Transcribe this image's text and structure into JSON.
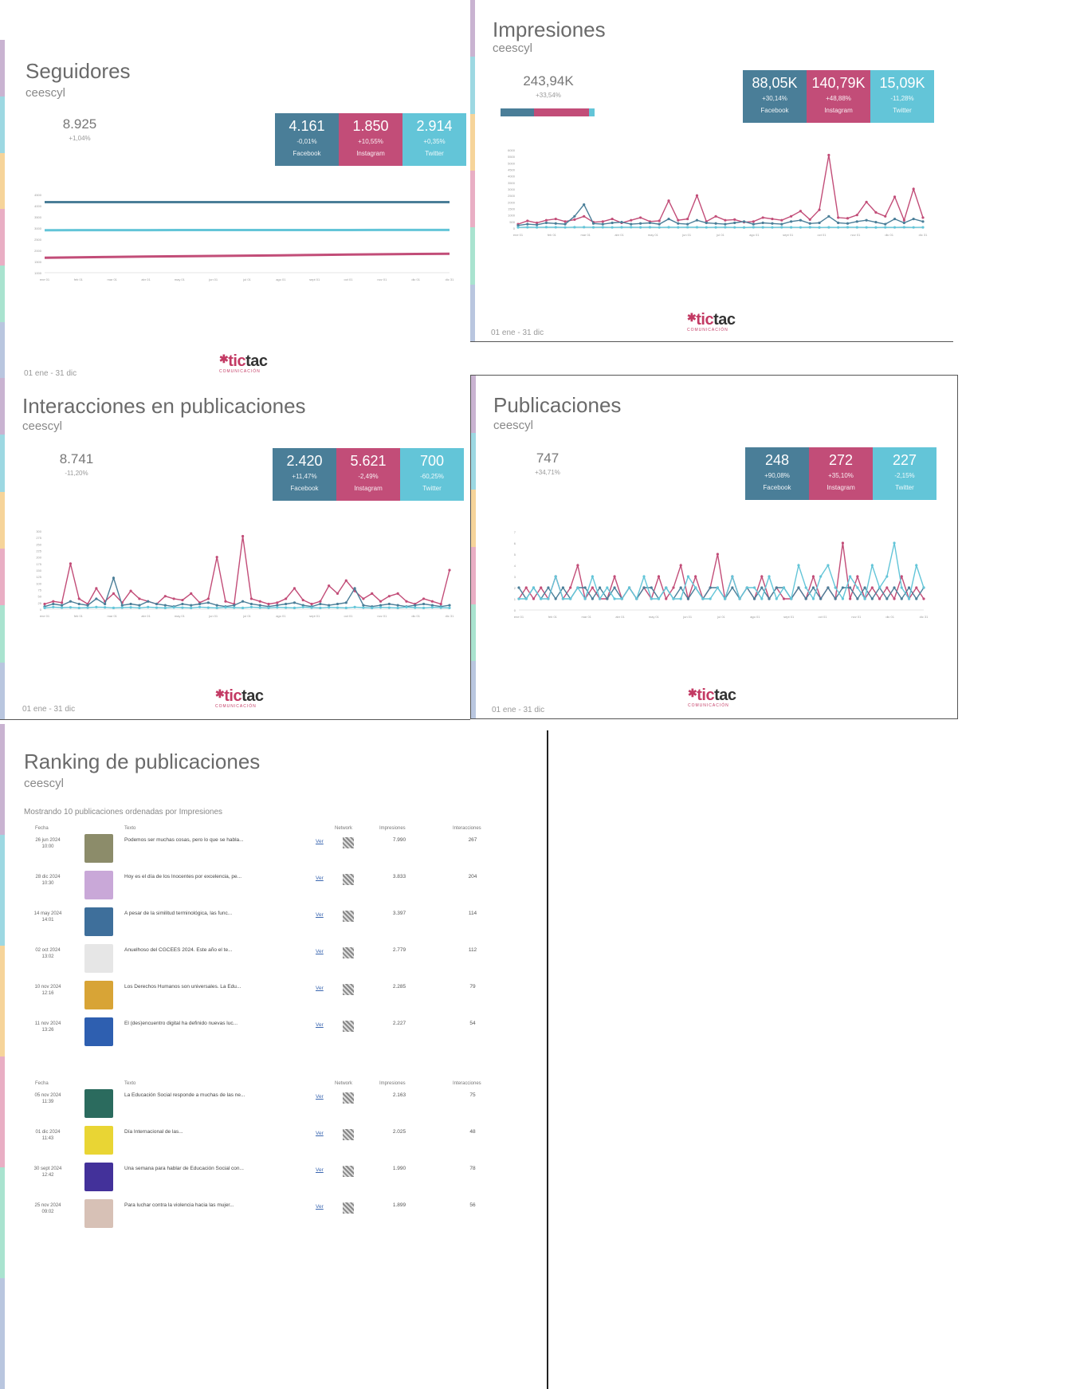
{
  "colors": {
    "facebook": "#4a7e98",
    "instagram": "#c24d78",
    "twitter": "#63c5d8",
    "stripe": [
      "#c9b3d1",
      "#9dd8e2",
      "#f6d49a",
      "#e9aec4",
      "#a9e3cf",
      "#b9c6df"
    ]
  },
  "account": "ceescyl",
  "date_range": "01 ene - 31 dic",
  "logo": {
    "name": "tictac",
    "tagline": "COMUNICACIÓN"
  },
  "seguidores": {
    "title": "Seguidores",
    "total": "8.925",
    "total_change": "+1,04%",
    "tiles": [
      {
        "value": "4.161",
        "change": "-0,01%",
        "network": "Facebook"
      },
      {
        "value": "1.850",
        "change": "+10,55%",
        "network": "Instagram"
      },
      {
        "value": "2.914",
        "change": "+0,35%",
        "network": "Twitter"
      }
    ]
  },
  "impresiones": {
    "title": "Impresiones",
    "total": "243,94K",
    "total_change": "+33,54%",
    "share": {
      "facebook": 0.36,
      "instagram": 0.58,
      "twitter": 0.06
    },
    "tiles": [
      {
        "value": "88,05K",
        "change": "+30,14%",
        "network": "Facebook"
      },
      {
        "value": "140,79K",
        "change": "+48,88%",
        "network": "Instagram"
      },
      {
        "value": "15,09K",
        "change": "-11,28%",
        "network": "Twitter"
      }
    ]
  },
  "interacciones": {
    "title": "Interacciones en publicaciones",
    "total": "8.741",
    "total_change": "-11,20%",
    "tiles": [
      {
        "value": "2.420",
        "change": "+11,47%",
        "network": "Facebook"
      },
      {
        "value": "5.621",
        "change": "-2,49%",
        "network": "Instagram"
      },
      {
        "value": "700",
        "change": "-60,25%",
        "network": "Twitter"
      }
    ]
  },
  "publicaciones": {
    "title": "Publicaciones",
    "total": "747",
    "total_change": "+34,71%",
    "tiles": [
      {
        "value": "248",
        "change": "+90,08%",
        "network": "Facebook"
      },
      {
        "value": "272",
        "change": "+35,10%",
        "network": "Instagram"
      },
      {
        "value": "227",
        "change": "-2,15%",
        "network": "Twitter"
      }
    ]
  },
  "ranking": {
    "title": "Ranking de publicaciones",
    "intro": "Mostrando 10 publicaciones ordenadas por Impresiones",
    "headers": {
      "fecha": "Fecha",
      "texto": "Texto",
      "network": "Network",
      "impresiones": "Impresiones",
      "interacciones": "Interacciones"
    },
    "ver_label": "Ver",
    "rows": [
      {
        "date": "26 jun 2024",
        "time": "10:00",
        "text": "Podemos ser muchas cosas, pero lo que se habla...",
        "impressions": "7.990",
        "interactions": "267",
        "thumb": "#8c8c6a"
      },
      {
        "date": "28 dic 2024",
        "time": "10:30",
        "text": "Hoy es el día de los Inocentes por excelencia, pe...",
        "impressions": "3.833",
        "interactions": "204",
        "thumb": "#c9a8d8"
      },
      {
        "date": "14 may 2024",
        "time": "14:01",
        "text": "A pesar de la similitud terminológica, las func...",
        "impressions": "3.397",
        "interactions": "114",
        "thumb": "#3e6f9b"
      },
      {
        "date": "02 oct 2024",
        "time": "13:02",
        "text": "Anuelhoso del CGCEES 2024. Este año el te...",
        "impressions": "2.779",
        "interactions": "112",
        "thumb": "#e6e6e6"
      },
      {
        "date": "10 nov 2024",
        "time": "12:16",
        "text": "Los Derechos Humanos son universales. La Edu...",
        "impressions": "2.285",
        "interactions": "79",
        "thumb": "#d8a436"
      },
      {
        "date": "11 nov 2024",
        "time": "13:26",
        "text": "El (des)encuentro digital ha definido nuevas luc...",
        "impressions": "2.227",
        "interactions": "54",
        "thumb": "#2e5fb0"
      },
      {
        "date": "05 nov 2024",
        "time": "11:39",
        "text": "La Educación Social responde a muchas de las ne...",
        "impressions": "2.163",
        "interactions": "75",
        "thumb": "#2b6b5e"
      },
      {
        "date": "01 dic 2024",
        "time": "11:43",
        "text": "Día Internacional de las...",
        "impressions": "2.025",
        "interactions": "48",
        "thumb": "#e9d534"
      },
      {
        "date": "30 sept 2024",
        "time": "12:42",
        "text": "Una semana para hablar de Educación Social con...",
        "impressions": "1.990",
        "interactions": "78",
        "thumb": "#43319a"
      },
      {
        "date": "25 nov 2024",
        "time": "09:02",
        "text": "Para luchar contra la violencia hacia las mujer...",
        "impressions": "1.899",
        "interactions": "56",
        "thumb": "#d7c1b6"
      }
    ]
  },
  "chart_data": [
    {
      "type": "line",
      "title": "Seguidores",
      "x": [
        "ene 01",
        "feb 01",
        "mar 01",
        "abr 01",
        "may 01",
        "jun 01",
        "jul 01",
        "ago 01",
        "sept 01",
        "oct 01",
        "nov 01",
        "dic 01",
        "dic 31"
      ],
      "ylim": [
        1000,
        4500
      ],
      "yticks": [
        "1000",
        "1500",
        "2000",
        "2500",
        "3000",
        "3500",
        "4000",
        "4500"
      ],
      "series": [
        {
          "name": "Facebook",
          "values": [
            4160,
            4161,
            4161,
            4162,
            4162,
            4162,
            4161,
            4161,
            4160,
            4160,
            4161,
            4161,
            4161
          ]
        },
        {
          "name": "Twitter",
          "values": [
            2905,
            2906,
            2907,
            2908,
            2909,
            2910,
            2910,
            2911,
            2912,
            2912,
            2913,
            2913,
            2914
          ]
        },
        {
          "name": "Instagram",
          "values": [
            1673,
            1690,
            1705,
            1720,
            1735,
            1750,
            1765,
            1780,
            1795,
            1810,
            1825,
            1838,
            1850
          ]
        }
      ]
    },
    {
      "type": "line",
      "title": "Impresiones",
      "x": [
        "ene 01",
        "feb 01",
        "mar 01",
        "abr 01",
        "may 01",
        "jun 01",
        "jul 01",
        "ago 01",
        "sept 01",
        "oct 01",
        "nov 01",
        "dic 01",
        "dic 31"
      ],
      "ylim": [
        0,
        6000
      ],
      "yticks": [
        "0",
        "500",
        "1000",
        "1500",
        "2000",
        "2500",
        "3000",
        "3500",
        "4000",
        "4500",
        "5000",
        "5500",
        "6000"
      ],
      "series": [
        {
          "name": "Instagram",
          "values": [
            300,
            550,
            400,
            600,
            700,
            500,
            650,
            900,
            450,
            500,
            700,
            400,
            600,
            800,
            500,
            550,
            2100,
            600,
            700,
            2500,
            500,
            900,
            600,
            650,
            450,
            500,
            800,
            700,
            600,
            900,
            1300,
            650,
            1400,
            5600,
            800,
            750,
            1000,
            2000,
            1200,
            900,
            2400,
            600,
            3000,
            800
          ]
        },
        {
          "name": "Facebook",
          "values": [
            200,
            300,
            250,
            400,
            350,
            300,
            900,
            1800,
            350,
            300,
            400,
            450,
            300,
            350,
            400,
            300,
            700,
            350,
            300,
            600,
            400,
            350,
            300,
            400,
            500,
            300,
            400,
            350,
            300,
            500,
            600,
            350,
            400,
            900,
            400,
            350,
            500,
            600,
            450,
            300,
            700,
            400,
            700,
            500
          ]
        },
        {
          "name": "Twitter",
          "values": [
            50,
            60,
            55,
            70,
            60,
            50,
            65,
            70,
            55,
            60,
            50,
            60,
            70,
            55,
            60,
            50,
            60,
            55,
            65,
            60,
            50,
            55,
            60,
            50,
            45,
            60,
            55,
            50,
            60,
            55,
            50,
            60,
            45,
            55,
            50,
            60,
            55,
            50,
            45,
            55,
            50,
            60,
            50,
            55
          ]
        }
      ]
    },
    {
      "type": "line",
      "title": "Interacciones en publicaciones",
      "x": [
        "ene 01",
        "feb 01",
        "mar 01",
        "abr 01",
        "may 01",
        "jun 01",
        "jul 01",
        "ago 01",
        "sept 01",
        "oct 01",
        "nov 01",
        "dic 01",
        "dic 31"
      ],
      "ylim": [
        0,
        300
      ],
      "yticks": [
        "0",
        "25",
        "50",
        "75",
        "100",
        "125",
        "150",
        "175",
        "200",
        "225",
        "250",
        "275",
        "300"
      ],
      "series": [
        {
          "name": "Instagram",
          "values": [
            20,
            30,
            25,
            175,
            40,
            20,
            80,
            30,
            60,
            25,
            70,
            40,
            30,
            20,
            50,
            40,
            35,
            60,
            25,
            40,
            200,
            30,
            20,
            280,
            40,
            30,
            20,
            25,
            40,
            80,
            35,
            20,
            30,
            90,
            60,
            110,
            70,
            40,
            60,
            30,
            50,
            60,
            30,
            20,
            40,
            30,
            20,
            150
          ]
        },
        {
          "name": "Facebook",
          "values": [
            10,
            20,
            15,
            30,
            20,
            15,
            40,
            20,
            120,
            15,
            20,
            15,
            30,
            20,
            15,
            10,
            20,
            15,
            20,
            25,
            15,
            10,
            15,
            30,
            20,
            15,
            10,
            15,
            20,
            25,
            15,
            10,
            20,
            15,
            20,
            25,
            80,
            15,
            10,
            15,
            20,
            15,
            10,
            15,
            20,
            15,
            10,
            15
          ]
        },
        {
          "name": "Twitter",
          "values": [
            5,
            8,
            6,
            7,
            5,
            6,
            8,
            7,
            5,
            6,
            7,
            5,
            8,
            6,
            5,
            7,
            6,
            5,
            8,
            6,
            5,
            7,
            6,
            5,
            8,
            6,
            5,
            7,
            6,
            5,
            8,
            6,
            5,
            7,
            6,
            5,
            8,
            6,
            5,
            7,
            6,
            5,
            8,
            6,
            5,
            7,
            6,
            5
          ]
        }
      ]
    },
    {
      "type": "line",
      "title": "Publicaciones",
      "x": [
        "ene 01",
        "feb 01",
        "mar 01",
        "abr 01",
        "may 01",
        "jun 01",
        "jul 01",
        "ago 01",
        "sept 01",
        "oct 01",
        "nov 01",
        "dic 01",
        "dic 31"
      ],
      "ylim": [
        0,
        7
      ],
      "yticks": [
        "0",
        "1",
        "2",
        "3",
        "4",
        "5",
        "6",
        "7"
      ],
      "series": [
        {
          "name": "Instagram",
          "values": [
            1,
            2,
            1,
            2,
            1,
            3,
            1,
            2,
            4,
            1,
            2,
            1,
            1,
            3,
            1,
            2,
            1,
            2,
            1,
            3,
            1,
            2,
            4,
            1,
            3,
            1,
            2,
            5,
            1,
            3,
            1,
            2,
            1,
            3,
            1,
            2,
            1,
            1,
            2,
            1,
            3,
            1,
            2,
            1,
            6,
            1,
            3,
            1,
            2,
            1,
            2,
            1,
            3,
            1,
            2,
            1
          ]
        },
        {
          "name": "Facebook",
          "values": [
            2,
            1,
            2,
            1,
            2,
            1,
            2,
            1,
            2,
            2,
            1,
            2,
            1,
            2,
            1,
            2,
            1,
            2,
            2,
            1,
            2,
            1,
            2,
            1,
            2,
            1,
            2,
            2,
            1,
            2,
            1,
            2,
            1,
            2,
            1,
            2,
            2,
            1,
            2,
            1,
            2,
            1,
            2,
            1,
            2,
            2,
            1,
            2,
            1,
            2,
            1,
            2,
            1,
            2,
            1,
            2
          ]
        },
        {
          "name": "Twitter",
          "values": [
            1,
            1,
            2,
            1,
            1,
            3,
            1,
            1,
            2,
            1,
            3,
            1,
            2,
            1,
            1,
            2,
            1,
            3,
            1,
            1,
            2,
            1,
            1,
            3,
            2,
            1,
            1,
            2,
            1,
            3,
            1,
            2,
            2,
            1,
            3,
            1,
            2,
            1,
            4,
            2,
            1,
            3,
            4,
            2,
            1,
            3,
            2,
            1,
            4,
            2,
            3,
            6,
            2,
            1,
            4,
            2
          ]
        }
      ]
    }
  ]
}
